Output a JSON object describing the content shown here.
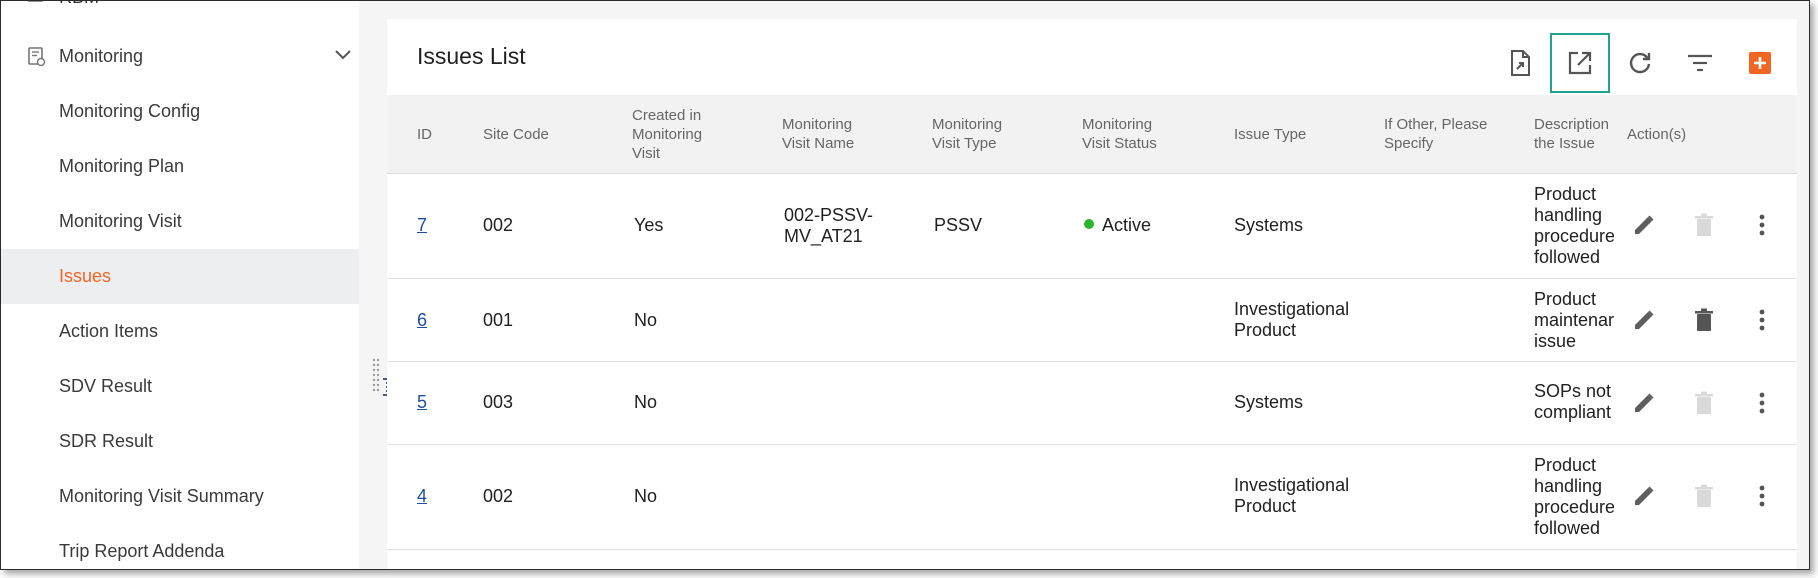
{
  "sidebar": {
    "top_partial_label": "RBM",
    "group_label": "Monitoring",
    "items": [
      {
        "label": "Monitoring Config",
        "active": false
      },
      {
        "label": "Monitoring Plan",
        "active": false
      },
      {
        "label": "Monitoring Visit",
        "active": false
      },
      {
        "label": "Issues",
        "active": true
      },
      {
        "label": "Action Items",
        "active": false
      },
      {
        "label": "SDV Result",
        "active": false
      },
      {
        "label": "SDR Result",
        "active": false
      },
      {
        "label": "Monitoring Visit Summary",
        "active": false
      },
      {
        "label": "Trip Report Addenda",
        "active": false
      }
    ]
  },
  "card": {
    "title": "Issues List",
    "toolbar": {
      "icons": [
        "export-document-icon",
        "open-external-icon",
        "refresh-icon",
        "filter-icon",
        "add-icon"
      ],
      "highlighted": "open-external-icon"
    }
  },
  "table": {
    "columns": {
      "id": "ID",
      "site_code": "Site Code",
      "created_in_visit": "Created in Monitoring Visit",
      "visit_name": "Monitoring Visit Name",
      "visit_type": "Monitoring Visit Type",
      "visit_status": "Monitoring Visit Status",
      "issue_type": "Issue Type",
      "if_other": "If Other, Please Specify",
      "description": "Description the Issue",
      "actions": "Action(s)"
    },
    "rows": [
      {
        "id": "7",
        "site_code": "002",
        "created_in_visit": "Yes",
        "visit_name": "002-PSSV-MV_AT21",
        "visit_type": "PSSV",
        "visit_status": "Active",
        "issue_type": "Systems",
        "if_other": "",
        "description": "Product handling procedure followed",
        "delete_enabled": false
      },
      {
        "id": "6",
        "site_code": "001",
        "created_in_visit": "No",
        "visit_name": "",
        "visit_type": "",
        "visit_status": "",
        "issue_type": "Investigational Product",
        "if_other": "",
        "description": "Product maintenar issue",
        "delete_enabled": true
      },
      {
        "id": "5",
        "site_code": "003",
        "created_in_visit": "No",
        "visit_name": "",
        "visit_type": "",
        "visit_status": "",
        "issue_type": "Systems",
        "if_other": "",
        "description": "SOPs not compliant",
        "delete_enabled": false
      },
      {
        "id": "4",
        "site_code": "002",
        "created_in_visit": "No",
        "visit_name": "",
        "visit_type": "",
        "visit_status": "",
        "issue_type": "Investigational Product",
        "if_other": "",
        "description": "Product handling procedure followed",
        "delete_enabled": false
      }
    ]
  },
  "colors": {
    "accent_orange": "#f26522",
    "highlight_teal": "#1fa58f",
    "link_blue": "#1f4e9c",
    "active_green": "#2bb52b"
  }
}
